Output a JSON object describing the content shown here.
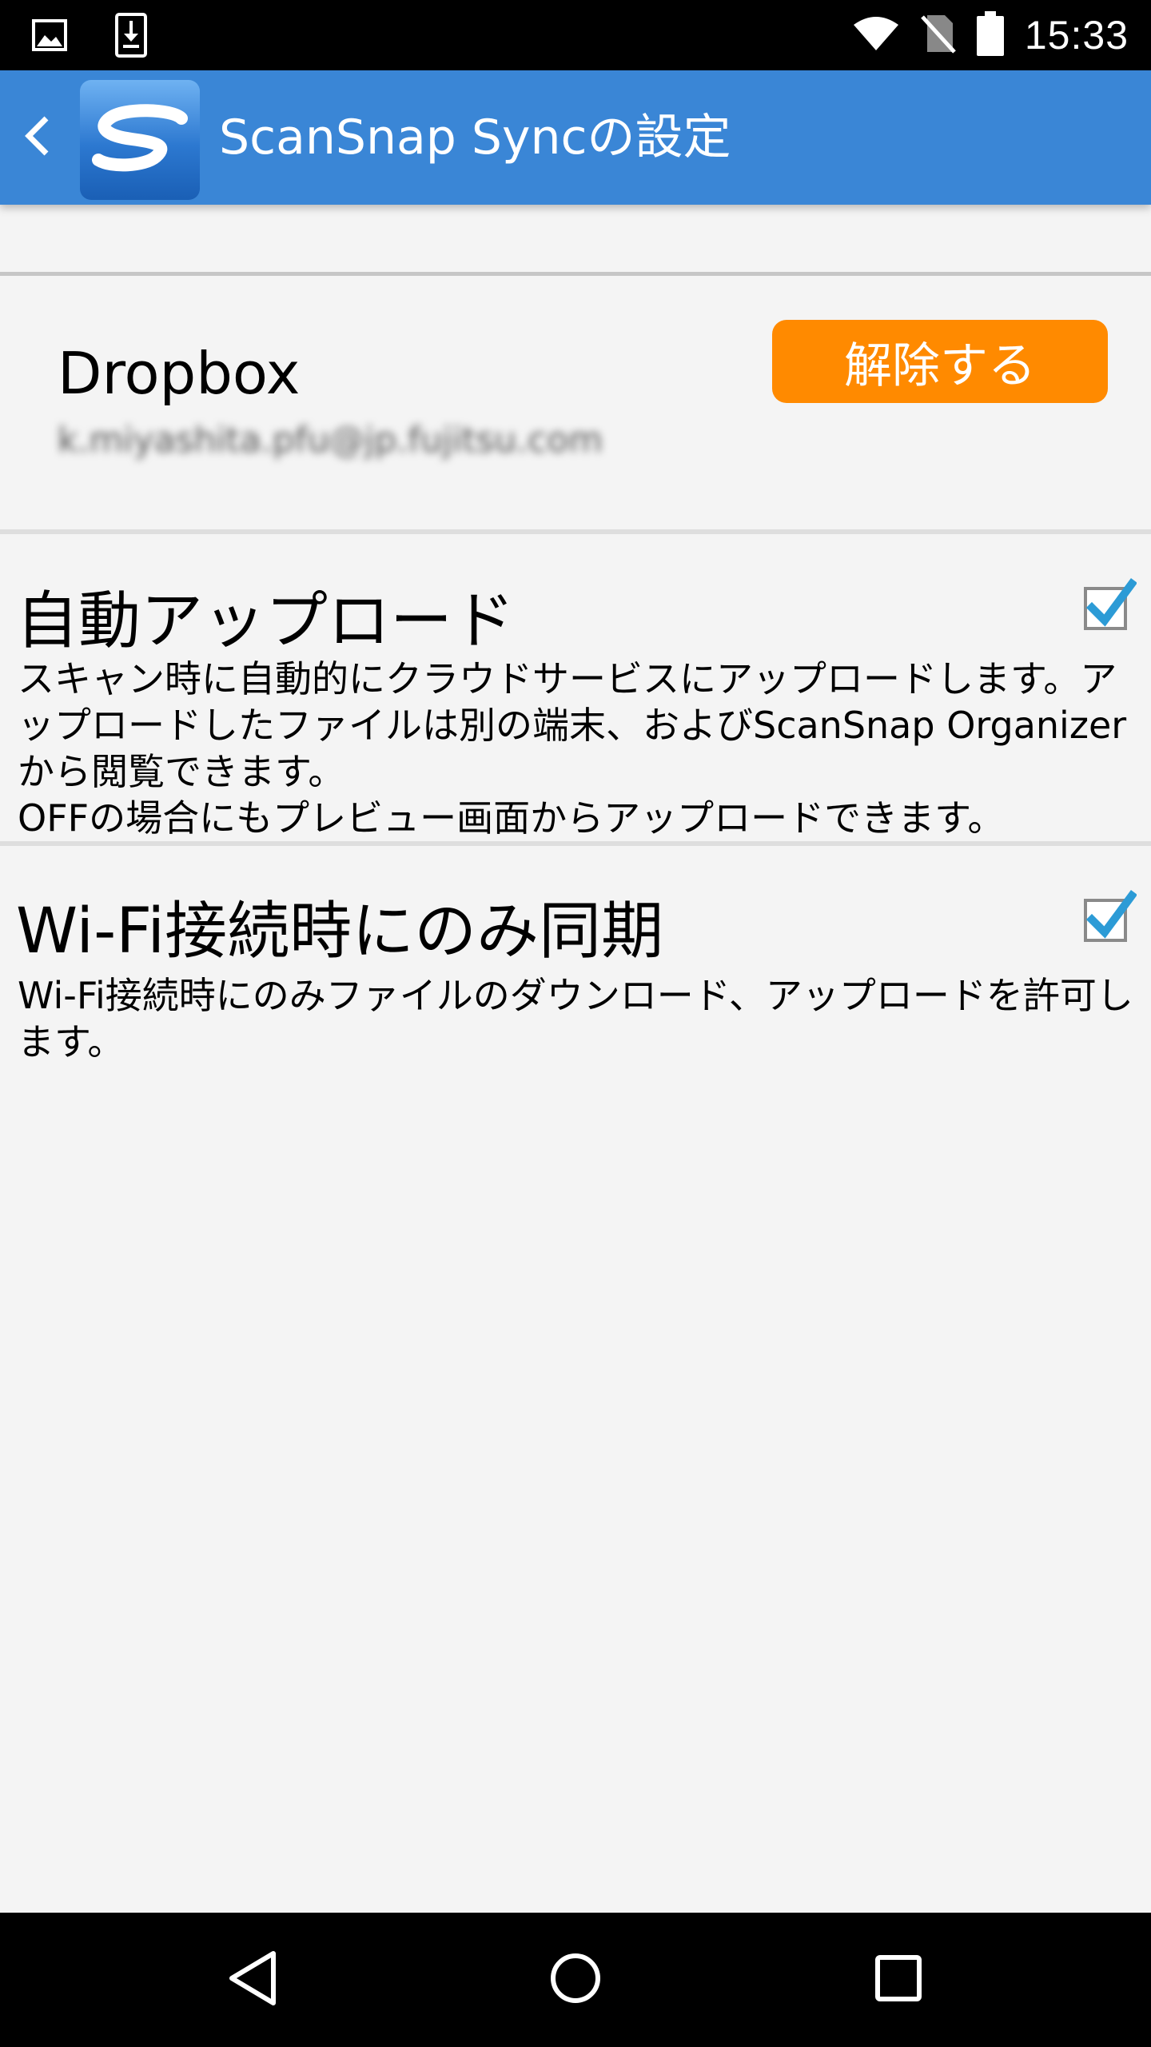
{
  "status_bar": {
    "time": "15:33",
    "left_icons": [
      "image-icon",
      "download-icon"
    ],
    "right_icons": [
      "wifi-icon",
      "no-sim-icon",
      "battery-icon"
    ]
  },
  "app_bar": {
    "title": "ScanSnap Syncの設定",
    "back_icon": "chevron-left-icon",
    "logo_icon": "scansnap-logo-icon",
    "color": "#3a86d6"
  },
  "account": {
    "service": "Dropbox",
    "email": "k.miyashita.pfu@jp.fujitsu.com",
    "unlink_label": "解除する",
    "unlink_color": "#ff8a00"
  },
  "settings": [
    {
      "title": "自動アップロード",
      "description": "スキャン時に自動的にクラウドサービスにアップロードします。アップロードしたファイルは別の端末、およびScanSnap Organizerから閲覧できます。\nOFFの場合にもプレビュー画面からアップロードできます。",
      "checked": true
    },
    {
      "title": "Wi-Fi接続時にのみ同期",
      "description": "Wi-Fi接続時にのみファイルのダウンロード、アップロードを許可します。",
      "checked": true
    }
  ],
  "nav_bar": {
    "icons": [
      "back-triangle-icon",
      "home-circle-icon",
      "recents-square-icon"
    ]
  },
  "colors": {
    "check_accent": "#2c9bd6",
    "background": "#f4f4f4"
  }
}
